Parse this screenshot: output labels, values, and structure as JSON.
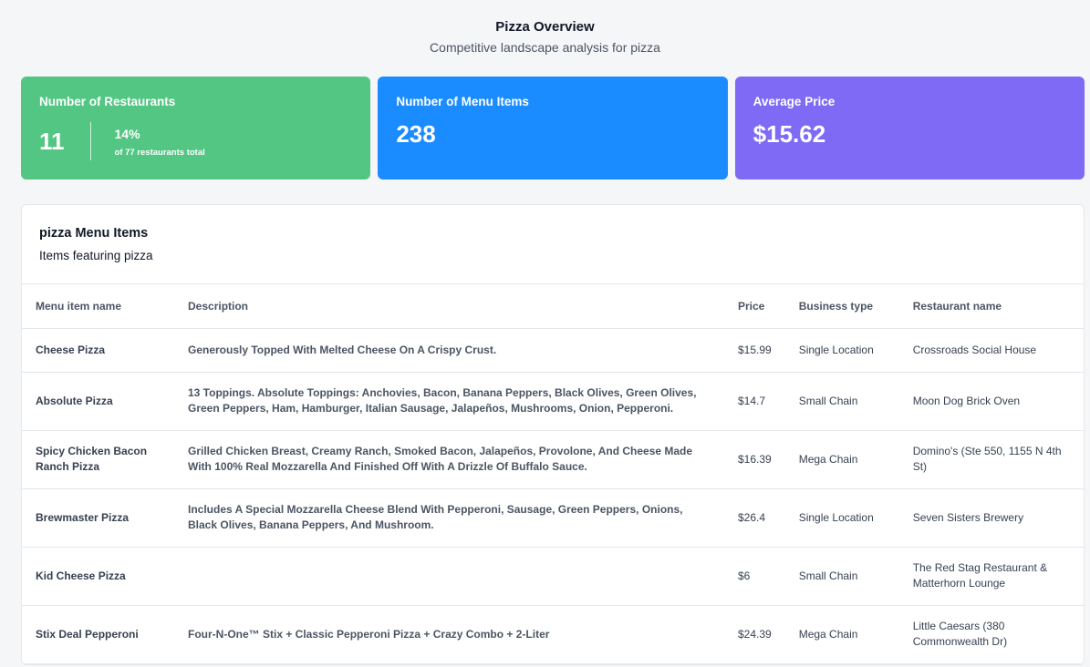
{
  "header": {
    "title": "Pizza Overview",
    "subtitle": "Competitive landscape analysis for pizza"
  },
  "cards": {
    "restaurants": {
      "label": "Number of Restaurants",
      "value": "11",
      "pct": "14%",
      "note": "of 77 restaurants total",
      "color": "#52c682"
    },
    "menu_items": {
      "label": "Number of Menu Items",
      "value": "238",
      "color": "#1a8cff"
    },
    "avg_price": {
      "label": "Average Price",
      "value": "$15.62",
      "color": "#7f6af5"
    }
  },
  "panel": {
    "title": "pizza Menu Items",
    "subtitle": "Items featuring pizza"
  },
  "table": {
    "columns": [
      "Menu item name",
      "Description",
      "Price",
      "Business type",
      "Restaurant name"
    ],
    "rows": [
      {
        "name": "Cheese Pizza",
        "desc": "Generously Topped With Melted Cheese On A Crispy Crust.",
        "price": "$15.99",
        "type": "Single Location",
        "restaurant": "Crossroads Social House"
      },
      {
        "name": "Absolute Pizza",
        "desc": "13 Toppings. Absolute Toppings: Anchovies, Bacon, Banana Peppers, Black Olives, Green Olives, Green Peppers, Ham, Hamburger, Italian Sausage, Jalapeños, Mushrooms, Onion, Pepperoni.",
        "price": "$14.7",
        "type": "Small Chain",
        "restaurant": "Moon Dog Brick Oven"
      },
      {
        "name": "Spicy Chicken Bacon Ranch Pizza",
        "desc": "Grilled Chicken Breast, Creamy Ranch, Smoked Bacon, Jalapeños, Provolone, And Cheese Made With 100% Real Mozzarella And Finished Off With A Drizzle Of Buffalo Sauce.",
        "price": "$16.39",
        "type": "Mega Chain",
        "restaurant": "Domino's (Ste 550, 1155 N 4th St)"
      },
      {
        "name": "Brewmaster Pizza",
        "desc": "Includes A Special Mozzarella Cheese Blend With Pepperoni, Sausage, Green Peppers, Onions, Black Olives, Banana Peppers, And Mushroom.",
        "price": "$26.4",
        "type": "Single Location",
        "restaurant": "Seven Sisters Brewery"
      },
      {
        "name": "Kid Cheese Pizza",
        "desc": "",
        "price": "$6",
        "type": "Small Chain",
        "restaurant": "The Red Stag Restaurant & Matterhorn Lounge"
      },
      {
        "name": "Stix Deal Pepperoni",
        "desc": "Four-N-One™ Stix + Classic Pepperoni Pizza + Crazy Combo + 2-Liter",
        "price": "$24.39",
        "type": "Mega Chain",
        "restaurant": "Little Caesars (380 Commonwealth Dr)"
      }
    ]
  }
}
